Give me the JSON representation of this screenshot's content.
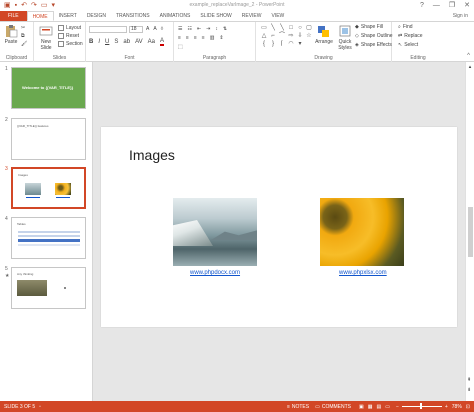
{
  "window": {
    "title": "example_replaceVarImage_2 - PowerPoint",
    "controls": [
      "?",
      "—",
      "❐",
      "✕"
    ]
  },
  "tabs": [
    {
      "label": "FILE"
    },
    {
      "label": "HOME"
    },
    {
      "label": "INSERT"
    },
    {
      "label": "DESIGN"
    },
    {
      "label": "TRANSITIONS"
    },
    {
      "label": "ANIMATIONS"
    },
    {
      "label": "SLIDE SHOW"
    },
    {
      "label": "REVIEW"
    },
    {
      "label": "VIEW"
    }
  ],
  "signin": "Sign in",
  "ribbon": {
    "clipboard": {
      "paste": "Paste",
      "label": "Clipboard"
    },
    "slides": {
      "new_slide": "New Slide",
      "layout": "Layout",
      "reset": "Reset",
      "section": "Section",
      "label": "Slides"
    },
    "font": {
      "size": "18",
      "label": "Font"
    },
    "paragraph": {
      "label": "Paragraph"
    },
    "drawing": {
      "arrange": "Arrange",
      "quick_styles": "Quick Styles",
      "shape_fill": "Shape Fill",
      "shape_outline": "Shape Outline",
      "shape_effects": "Shape Effects",
      "label": "Drawing"
    },
    "editing": {
      "find": "Find",
      "replace": "Replace",
      "select": "Select",
      "label": "Editing"
    }
  },
  "thumbnails": [
    {
      "num": "1",
      "text": "Welcome to {{VAR_TITLE}}"
    },
    {
      "num": "2",
      "text": "{{VAR_TITLE}} features"
    },
    {
      "num": "3",
      "text": "Images"
    },
    {
      "num": "4",
      "text": "Tables"
    },
    {
      "num": "5",
      "text": "Any thinking"
    }
  ],
  "slide": {
    "title": "Images",
    "link1": "www.phpdocx.com",
    "link2": "www.phpxlsx.com"
  },
  "status": {
    "slide_info": "SLIDE 3 OF 5",
    "notes": "NOTES",
    "comments": "COMMENTS",
    "zoom": "78%"
  },
  "colors": {
    "accent": "#d24726",
    "thumb1_bg": "#6aa84f",
    "link": "#1155cc"
  }
}
